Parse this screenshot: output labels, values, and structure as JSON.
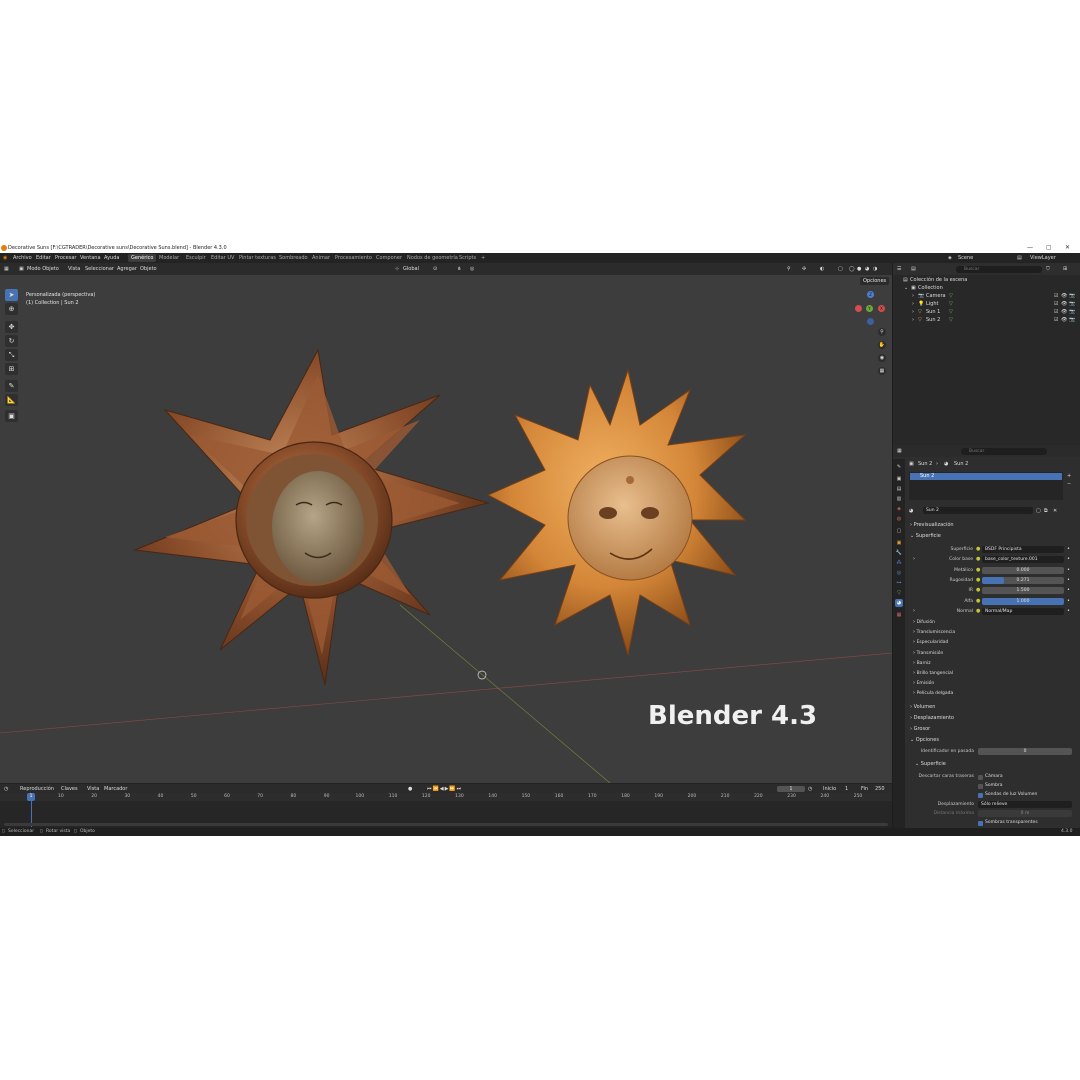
{
  "window": {
    "title": "Decorative Suns [F:\\CGTRADER\\Decorative suns\\Decorative Suns.blend] - Blender 4.3.0",
    "controls": [
      "—",
      "▢",
      "✕"
    ]
  },
  "menu": {
    "items": [
      "Archivo",
      "Editar",
      "Procesar",
      "Ventana",
      "Ayuda"
    ],
    "workspaces": [
      "Genérico",
      "Modelar",
      "Esculpir",
      "Editar UV",
      "Pintar texturas",
      "Sombreado",
      "Animar",
      "Procesamiento",
      "Componer",
      "Nodos de geometría",
      "Scripts"
    ],
    "active_workspace": "Genérico",
    "add_tab": "+",
    "scene_name": "Scene",
    "view_layer": "ViewLayer"
  },
  "viewport_header": {
    "mode": "Modo Objeto",
    "menus": [
      "Vista",
      "Seleccionar",
      "Agregar",
      "Objeto"
    ],
    "transform": "Global",
    "options": "Opciones"
  },
  "viewport": {
    "view_name": "Personalizada (perspectiva)",
    "collection_info": "(1) Collection | Sun 2",
    "watermark": "Blender 4.3",
    "gizmo": {
      "x": "X",
      "y": "Y",
      "z": "Z"
    }
  },
  "timeline": {
    "menus": [
      "Reproducción",
      "Claves",
      "Vista",
      "Marcador"
    ],
    "current_frame": "1",
    "start_label": "Inicio",
    "start": "1",
    "end_label": "Fin",
    "end": "250",
    "ticks": [
      "1",
      "10",
      "20",
      "30",
      "40",
      "50",
      "60",
      "70",
      "80",
      "90",
      "100",
      "110",
      "120",
      "130",
      "140",
      "150",
      "160",
      "170",
      "180",
      "190",
      "200",
      "210",
      "220",
      "230",
      "240",
      "250"
    ]
  },
  "statusbar": {
    "items": [
      "Seleccionar",
      "Rotar vista",
      "Objeto"
    ],
    "version": "4.3.0"
  },
  "outliner": {
    "search_placeholder": "Buscar",
    "root": "Colección de la escena",
    "collection": "Collection",
    "objects": [
      {
        "name": "Camera",
        "icon": "camera-icon"
      },
      {
        "name": "Light",
        "icon": "light-icon"
      },
      {
        "name": "Sun 1",
        "icon": "mesh-icon"
      },
      {
        "name": "Sun 2",
        "icon": "mesh-icon"
      }
    ]
  },
  "properties": {
    "search_placeholder": "Buscar",
    "breadcrumb": [
      "Sun 2",
      "Sun 2"
    ],
    "material_slot": "Sun 2",
    "material_name": "Sun 2",
    "panels": {
      "preview": "Previsualización",
      "surface": "Superficie",
      "volume": "Volumen",
      "displacement": "Desplazamiento",
      "thickness": "Grosor",
      "options": "Opciones",
      "options_surface": "Superficie"
    },
    "fields": [
      {
        "label": "Superficie",
        "value": "BSDF Principista",
        "kind": "dark"
      },
      {
        "label": "Color base",
        "value": "base_color_texture.001",
        "kind": "dark"
      },
      {
        "label": "Metálico",
        "value": "0.000",
        "fill": 0.0
      },
      {
        "label": "Rugosidad",
        "value": "0.271",
        "fill": 0.271
      },
      {
        "label": "IR",
        "value": "1.500",
        "fill": 0.0
      },
      {
        "label": "Alfa",
        "value": "1.000",
        "fill": 1.0
      },
      {
        "label": "Normal",
        "value": "Normal/Map",
        "kind": "dark"
      }
    ],
    "subpanels": [
      "Difusión",
      "Translumiscencia",
      "Especularidad",
      "Transmisión",
      "Barniz",
      "Brillo tangencial",
      "Emisión",
      "Película delgada"
    ],
    "pass_index_label": "Identificador en pasada",
    "pass_index": "0",
    "backface_label": "Descartar caras traseras",
    "checks": [
      {
        "label": "Cámara",
        "on": false
      },
      {
        "label": "Sombra",
        "on": false
      },
      {
        "label": "Sondas de luz Volumen",
        "on": true
      }
    ],
    "displacement_label": "Desplazamiento",
    "displacement_value": "Sólo relieve",
    "max_distance_label": "Distancia máxima",
    "max_distance_value": "0 m",
    "transparent_shadows": "Sombras transparentes"
  },
  "colors": {
    "accent": "#4772b3",
    "blender_orange": "#e87d0d",
    "sun1": "#a8643a",
    "sun2": "#d98a3a"
  }
}
